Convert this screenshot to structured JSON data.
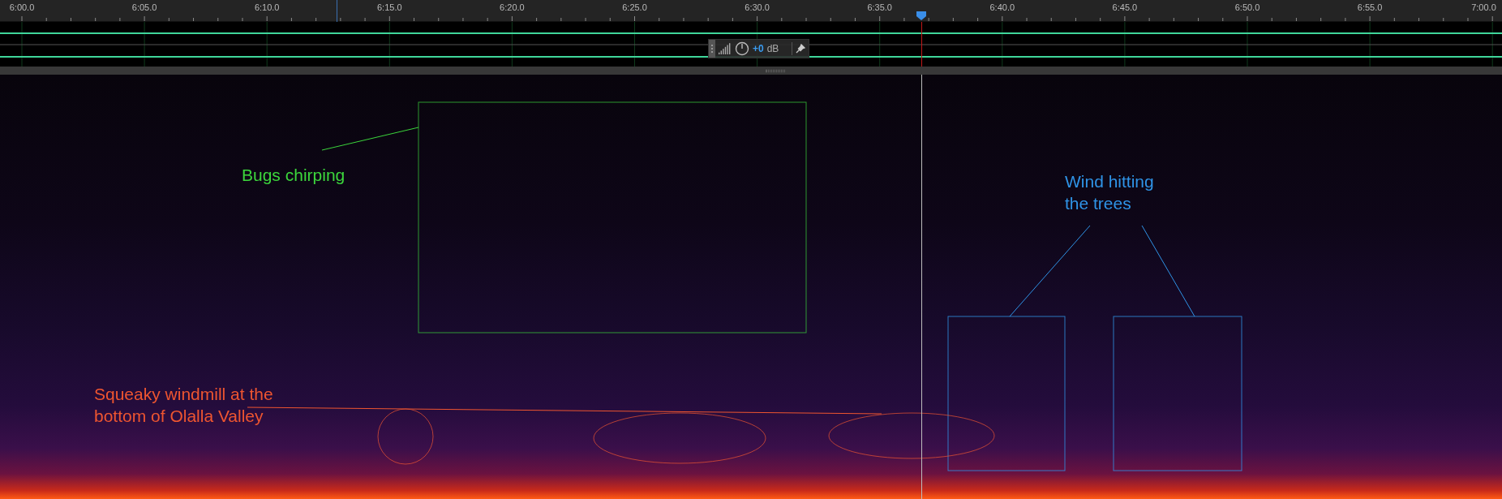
{
  "ruler": {
    "labels": [
      "6:00.0",
      "6:05.0",
      "6:10.0",
      "6:15.0",
      "6:20.0",
      "6:25.0",
      "6:30.0",
      "6:35.0",
      "6:40.0",
      "6:45.0",
      "6:50.0",
      "6:55.0",
      "7:00.0"
    ]
  },
  "gain_control": {
    "value": "+0",
    "unit": "dB"
  },
  "annotations": [
    {
      "kind": "box",
      "label": "Bugs chirping",
      "color": "#3cd63c"
    },
    {
      "kind": "twin_box",
      "label": "Wind hitting\nthe trees",
      "color": "#2f93e6"
    },
    {
      "kind": "ellipses",
      "label": "Squeaky windmill at the\nbottom of Olalla Valley",
      "color": "#ee5530"
    }
  ]
}
